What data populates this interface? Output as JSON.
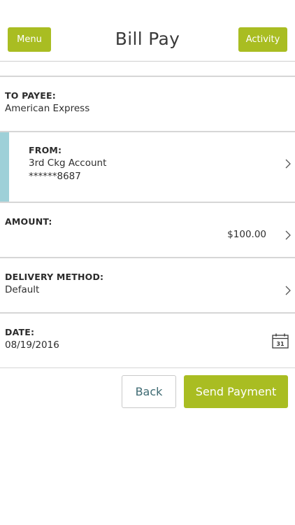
{
  "header": {
    "menu_label": "Menu",
    "title": "Bill Pay",
    "activity_label": "Activity"
  },
  "payee": {
    "label": "TO PAYEE:",
    "value": "American Express"
  },
  "from": {
    "label": "FROM:",
    "account_name": "3rd Ckg Account",
    "account_number": "******8687"
  },
  "amount": {
    "label": "AMOUNT:",
    "value": "$100.00"
  },
  "delivery": {
    "label": "DELIVERY METHOD:",
    "value": "Default"
  },
  "date": {
    "label": "DATE:",
    "value": "08/19/2016",
    "calendar_icon_day": "31"
  },
  "actions": {
    "back_label": "Back",
    "send_label": "Send Payment"
  },
  "colors": {
    "accent_green": "#a9bd22",
    "from_accent_blue": "#9ed0d8",
    "divider": "#d6d6d6"
  },
  "icons": {
    "chevron": "chevron-right-icon",
    "calendar": "calendar-icon"
  }
}
